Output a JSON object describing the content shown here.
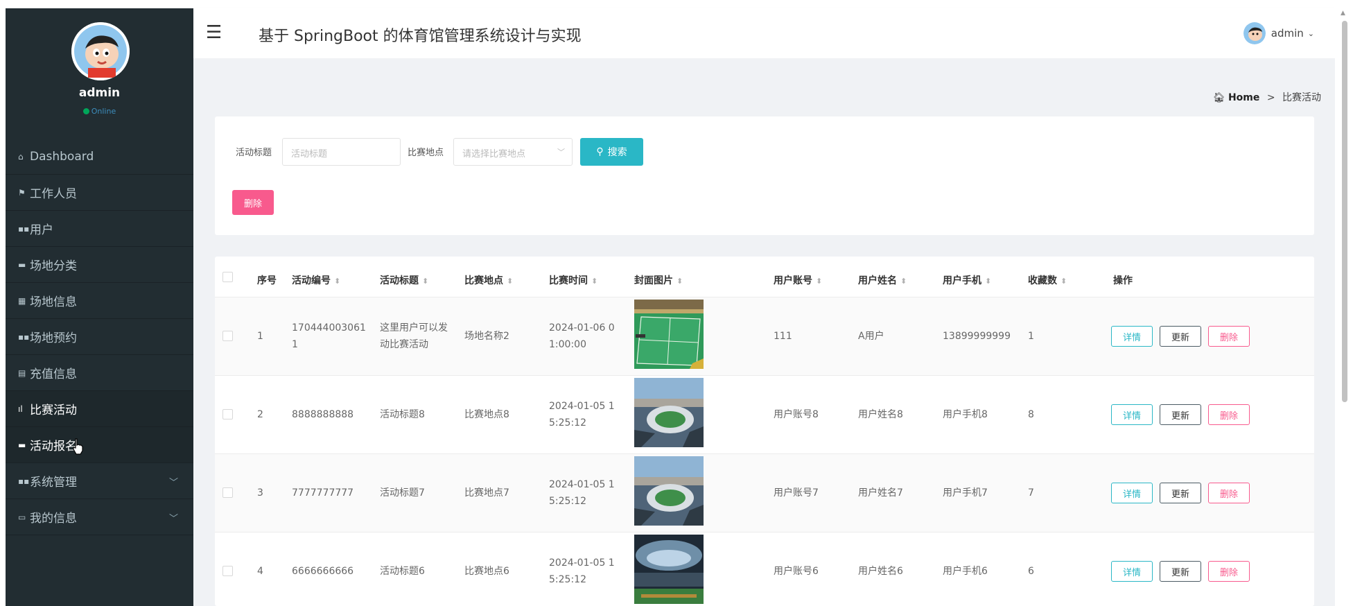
{
  "app": {
    "title": "基于 SpringBoot 的体育馆管理系统设计与实现",
    "user": "admin",
    "status": "Online"
  },
  "sidebar": {
    "items": [
      {
        "icon": "home-icon",
        "label": "Dashboard"
      },
      {
        "icon": "flag-icon",
        "label": "工作人员"
      },
      {
        "icon": "grid-icon",
        "label": "用户"
      },
      {
        "icon": "car-icon",
        "label": "场地分类"
      },
      {
        "icon": "book-icon",
        "label": "场地信息"
      },
      {
        "icon": "grid-icon",
        "label": "场地预约"
      },
      {
        "icon": "file-icon",
        "label": "充值信息"
      },
      {
        "icon": "bar-chart-icon",
        "label": "比赛活动"
      },
      {
        "icon": "car-icon",
        "label": "活动报名"
      },
      {
        "icon": "grid-icon",
        "label": "系统管理"
      },
      {
        "icon": "window-icon",
        "label": "我的信息"
      }
    ],
    "active": "比赛活动"
  },
  "breadcrumb": {
    "home": "Home",
    "sep": ">",
    "current": "比赛活动"
  },
  "search": {
    "title_label": "活动标题",
    "title_placeholder": "活动标题",
    "place_label": "比赛地点",
    "place_placeholder": "请选择比赛地点",
    "search_button": "搜索",
    "delete_button": "删除"
  },
  "table": {
    "headers": [
      "序号",
      "活动编号",
      "活动标题",
      "比赛地点",
      "比赛时间",
      "封面图片",
      "用户账号",
      "用户姓名",
      "用户手机",
      "收藏数",
      "操作"
    ],
    "actions": {
      "detail": "详情",
      "update": "更新",
      "delete": "删除"
    },
    "rows": [
      {
        "index": "1",
        "code_l1": "170444003061",
        "code_l2": "1",
        "title_l1": "这里用户可以发",
        "title_l2": "动比赛活动",
        "place": "场地名称2",
        "time_l1": "2024-01-06 0",
        "time_l2": "1:00:00",
        "cover": "badminton-court-image",
        "account": "111",
        "name": "A用户",
        "phone": "13899999999",
        "favorites": "1"
      },
      {
        "index": "2",
        "code_l1": "8888888888",
        "code_l2": "",
        "title_l1": "活动标题8",
        "title_l2": "",
        "place": "比赛地点8",
        "time_l1": "2024-01-05 1",
        "time_l2": "5:25:12",
        "cover": "stadium-aerial-image",
        "account": "用户账号8",
        "name": "用户姓名8",
        "phone": "用户手机8",
        "favorites": "8"
      },
      {
        "index": "3",
        "code_l1": "7777777777",
        "code_l2": "",
        "title_l1": "活动标题7",
        "title_l2": "",
        "place": "比赛地点7",
        "time_l1": "2024-01-05 1",
        "time_l2": "5:25:12",
        "cover": "stadium-aerial-image",
        "account": "用户账号7",
        "name": "用户姓名7",
        "phone": "用户手机7",
        "favorites": "7"
      },
      {
        "index": "4",
        "code_l1": "6666666666",
        "code_l2": "",
        "title_l1": "活动标题6",
        "title_l2": "",
        "place": "比赛地点6",
        "time_l1": "2024-01-05 1",
        "time_l2": "5:25:12",
        "cover": "stadium-interior-image",
        "account": "用户账号6",
        "name": "用户姓名6",
        "phone": "用户手机6",
        "favorites": "6"
      }
    ]
  },
  "colors": {
    "sidebar_bg": "#222d32",
    "primary": "#2ab7c6",
    "danger": "#f85a8d",
    "online": "#00a65a"
  }
}
